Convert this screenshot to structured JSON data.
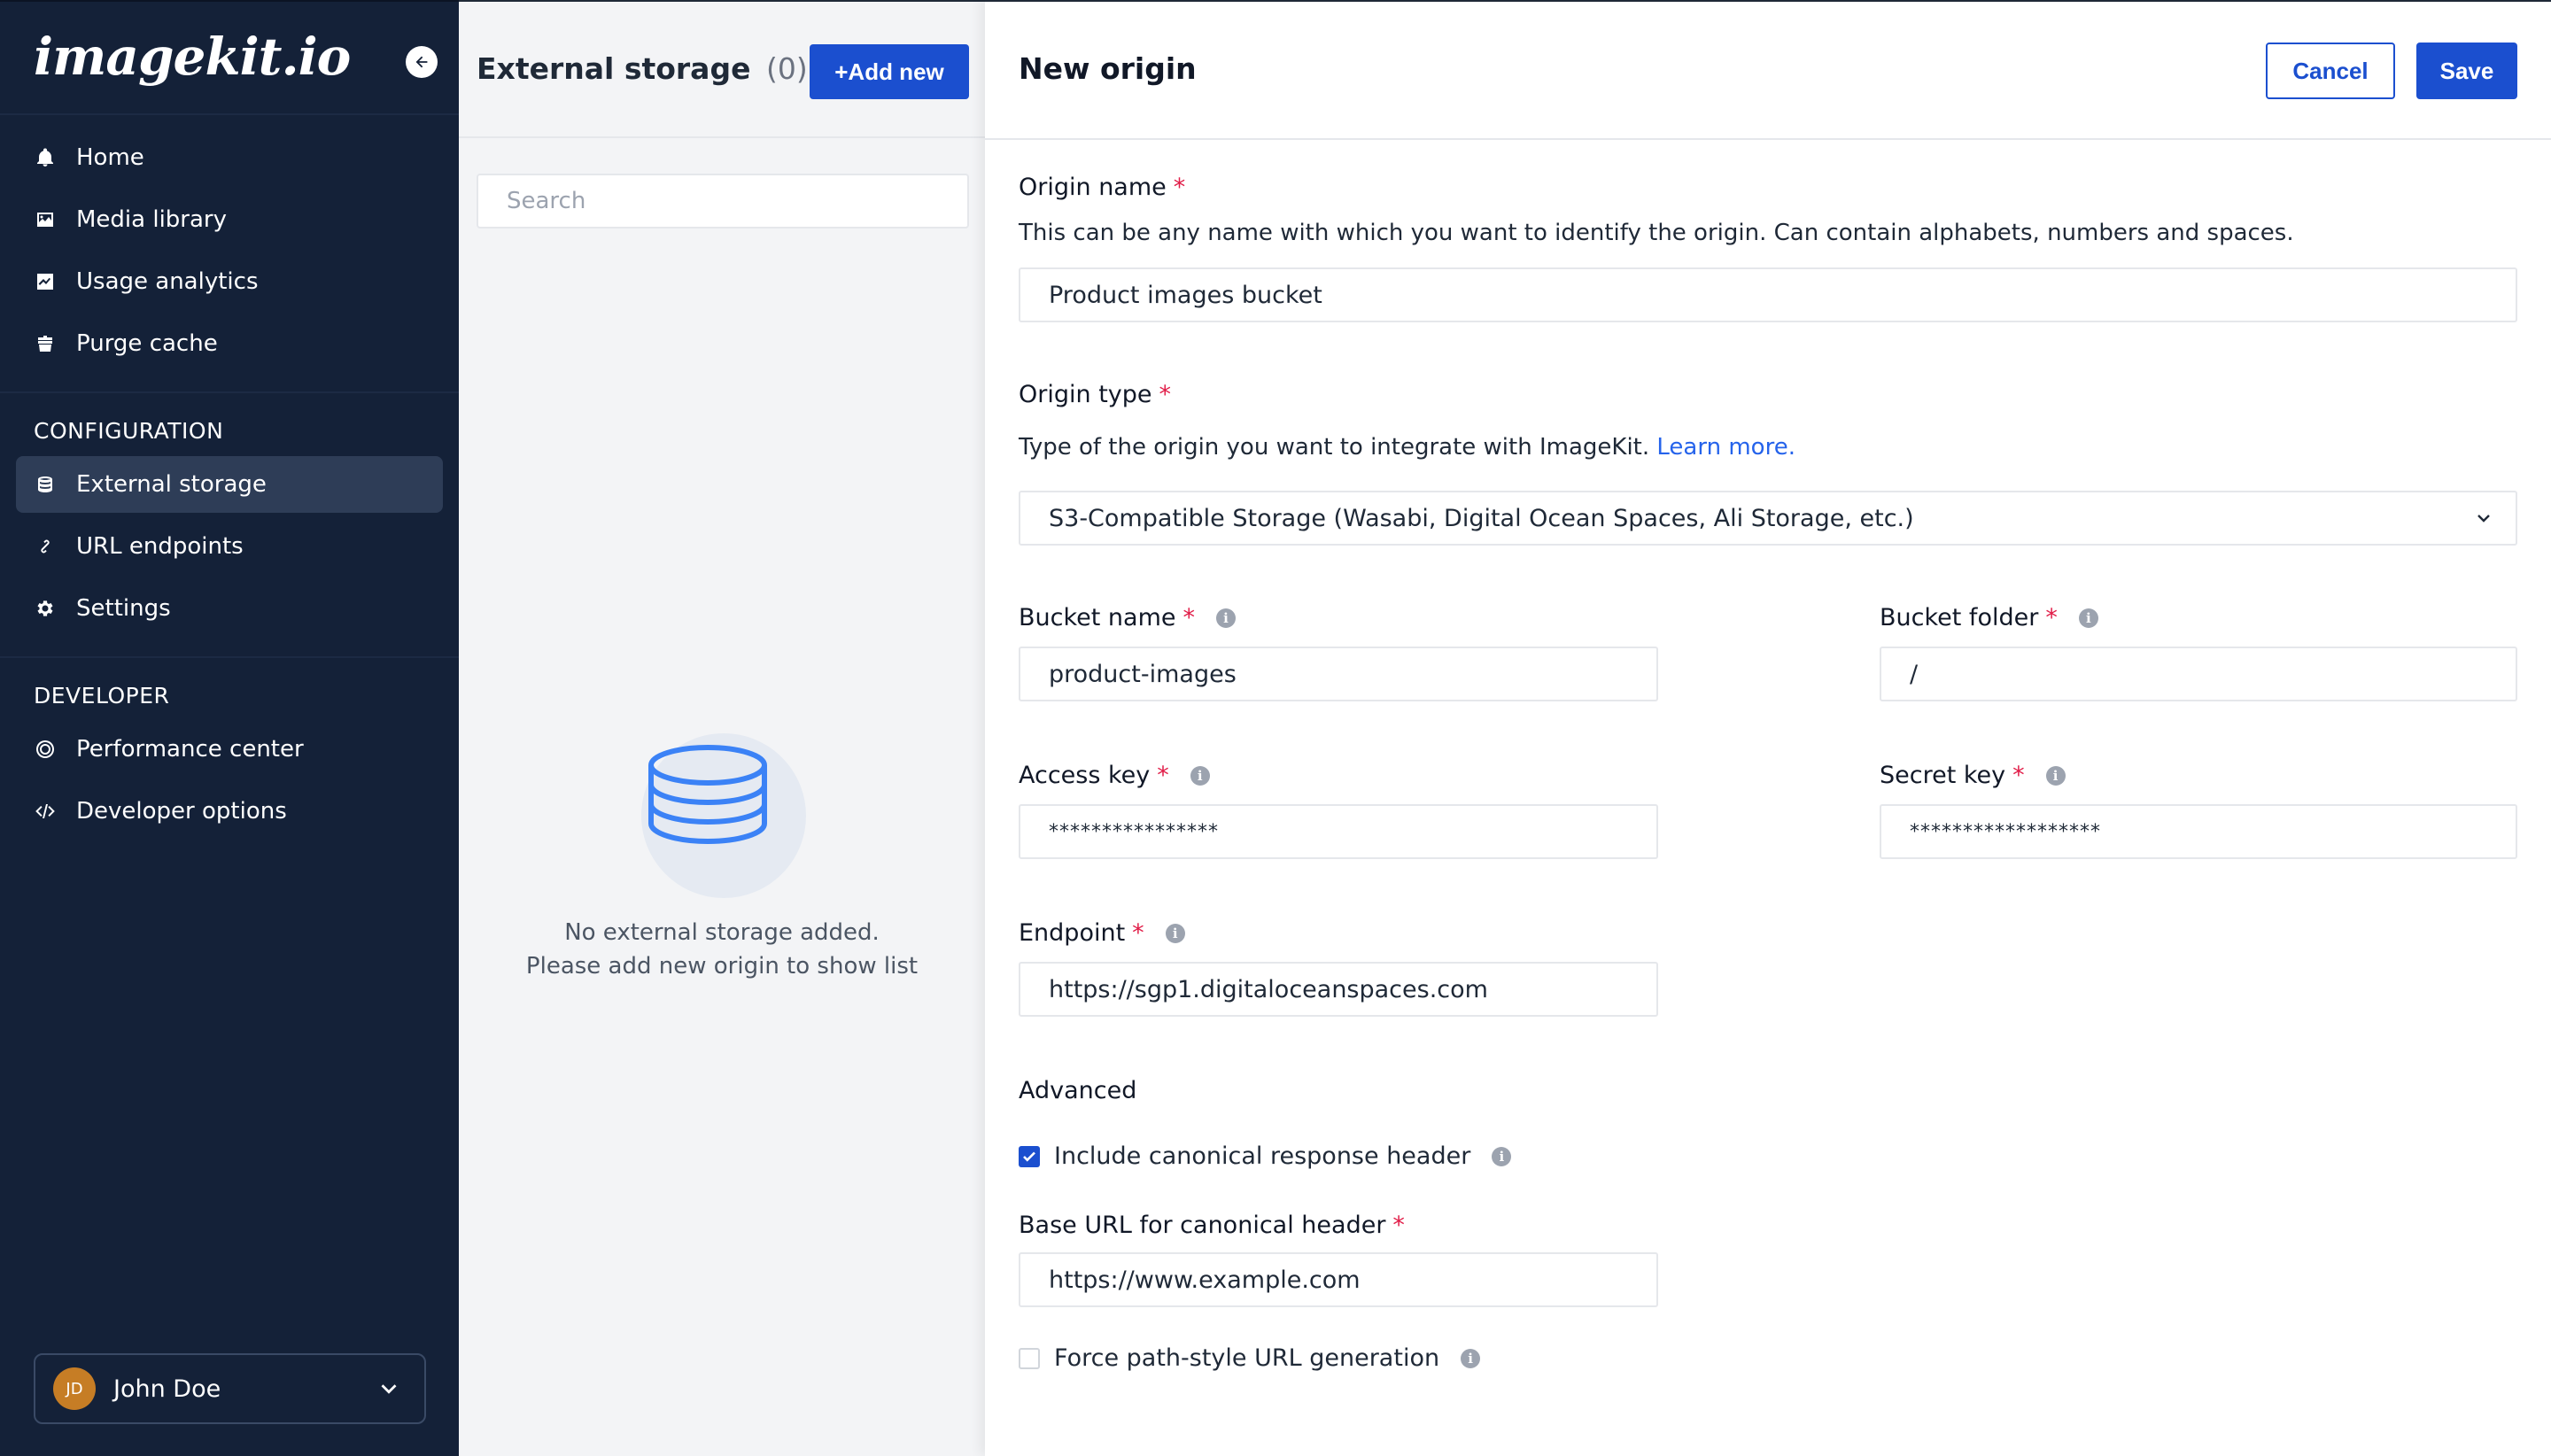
{
  "sidebar": {
    "logo": "imagekit.io",
    "main_items": [
      {
        "label": "Home",
        "icon": "bell-icon"
      },
      {
        "label": "Media library",
        "icon": "media-icon"
      },
      {
        "label": "Usage analytics",
        "icon": "analytics-icon"
      },
      {
        "label": "Purge cache",
        "icon": "purge-icon"
      }
    ],
    "config_title": "CONFIGURATION",
    "config_items": [
      {
        "label": "External storage",
        "icon": "storage-icon",
        "active": true
      },
      {
        "label": "URL endpoints",
        "icon": "link-icon"
      },
      {
        "label": "Settings",
        "icon": "gear-icon"
      }
    ],
    "developer_title": "DEVELOPER",
    "developer_items": [
      {
        "label": "Performance center",
        "icon": "performance-icon"
      },
      {
        "label": "Developer options",
        "icon": "code-icon"
      }
    ],
    "user": {
      "initials": "JD",
      "name": "John Doe"
    }
  },
  "storage_list": {
    "title": "External storage",
    "count": "(0)",
    "add_label": "+Add new",
    "search_placeholder": "Search",
    "empty_line1": "No external storage added.",
    "empty_line2": "Please add new origin to show list"
  },
  "form": {
    "title": "New origin",
    "cancel_label": "Cancel",
    "save_label": "Save",
    "origin_name": {
      "label": "Origin name",
      "description": "This can be any name with which you want to identify the origin. Can contain alphabets, numbers and spaces.",
      "value": "Product images bucket"
    },
    "origin_type": {
      "label": "Origin type",
      "description": "Type of the origin you want to integrate with ImageKit.",
      "link_text": "Learn more.",
      "value": "S3-Compatible Storage (Wasabi, Digital Ocean Spaces, Ali Storage, etc.)"
    },
    "bucket_name": {
      "label": "Bucket name",
      "value": "product-images"
    },
    "bucket_folder": {
      "label": "Bucket folder",
      "value": "/"
    },
    "access_key": {
      "label": "Access key",
      "value": "****************"
    },
    "secret_key": {
      "label": "Secret key",
      "value": "******************"
    },
    "endpoint": {
      "label": "Endpoint",
      "value": "https://sgp1.digitaloceanspaces.com"
    },
    "advanced_title": "Advanced",
    "canonical_header": {
      "label": "Include canonical response header",
      "checked": true
    },
    "base_url": {
      "label": "Base URL for canonical header",
      "value": "https://www.example.com"
    },
    "force_path_style": {
      "label": "Force path-style URL generation",
      "checked": false
    },
    "required_marker": "*",
    "info_glyph": "i"
  },
  "colors": {
    "sidebar_bg": "#142138",
    "accent": "#1b4fcf",
    "required": "#e11d48",
    "link": "#2563eb"
  }
}
